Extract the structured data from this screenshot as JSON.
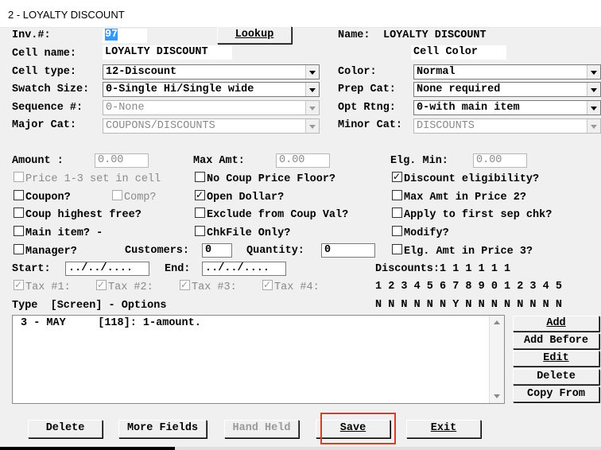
{
  "window": {
    "title": "2 - LOYALTY DISCOUNT"
  },
  "form": {
    "inv_label": "Inv.#:",
    "inv_value": "97",
    "lookup_label": "Lookup",
    "name_label": "Name:",
    "name_value": "LOYALTY DISCOUNT",
    "cell_name_label": "Cell name:",
    "cell_name_value": "LOYALTY DISCOUNT",
    "cell_color_label": "Cell Color",
    "cell_type_label": "Cell type:",
    "cell_type_value": "12-Discount",
    "color_label": "Color:",
    "color_value": "Normal",
    "swatch_label": "Swatch Size:",
    "swatch_value": "0-Single Hi/Single wide",
    "prep_label": "Prep Cat:",
    "prep_value": "None required",
    "sequence_label": "Sequence #:",
    "sequence_value": "0-None",
    "opt_label": "Opt Rtng:",
    "opt_value": "0-with main item",
    "major_label": "Major Cat:",
    "major_value": "COUPONS/DISCOUNTS",
    "minor_label": "Minor Cat:",
    "minor_value": "DISCOUNTS",
    "amount_label": "Amount :",
    "amount_value": "0.00",
    "maxamt_label": "Max Amt:",
    "maxamt_value": "0.00",
    "elgmin_label": "Elg. Min:",
    "elgmin_value": "0.00",
    "customers_label": "Customers:",
    "customers_value": "0",
    "quantity_label": "Quantity:",
    "quantity_value": "0",
    "start_label": "Start:",
    "start_value": "../../....",
    "end_label": "End:",
    "end_value": "../../...."
  },
  "checkboxes": {
    "price13": {
      "label": "Price 1-3 set in cell",
      "checked": false
    },
    "no_coup_floor": {
      "label": "No Coup Price Floor?",
      "checked": false
    },
    "discount_elig": {
      "label": "Discount eligibility?",
      "checked": true
    },
    "coupon": {
      "label": "Coupon?",
      "checked": false
    },
    "comp": {
      "label": "Comp?",
      "checked": false
    },
    "open_dollar": {
      "label": "Open Dollar?",
      "checked": true
    },
    "max_amt_price2": {
      "label": "Max Amt in Price 2?",
      "checked": false
    },
    "coup_highest": {
      "label": "Coup highest free?",
      "checked": false
    },
    "exclude_coup": {
      "label": "Exclude from Coup Val?",
      "checked": false
    },
    "apply_first": {
      "label": "Apply to first sep chk?",
      "checked": false
    },
    "main_item": {
      "label": "Main item? -",
      "checked": false
    },
    "chkfile": {
      "label": "ChkFile Only?",
      "checked": false
    },
    "modify": {
      "label": "Modify?",
      "checked": false
    },
    "manager": {
      "label": "Manager?",
      "checked": false
    },
    "elg_amt_price3": {
      "label": "Elg. Amt in Price 3?",
      "checked": false
    },
    "tax1": {
      "label": "Tax #1:",
      "checked": true
    },
    "tax2": {
      "label": "Tax #2:",
      "checked": true
    },
    "tax3": {
      "label": "Tax #3:",
      "checked": true
    },
    "tax4": {
      "label": "Tax #4:",
      "checked": true
    }
  },
  "discounts": {
    "label": "Discounts:",
    "tens": "          1 1 1 1 1 1",
    "ones": "1 2 3 4 5 6 7 8 9 0 1 2 3 4 5",
    "flags": "N N N N N N Y N N N N N N N N"
  },
  "options": {
    "header": "Type  [Screen] - Options",
    "rows": [
      "3 - MAY     [118]: 1-amount."
    ]
  },
  "side_buttons": {
    "add": "Add",
    "add_before": "Add Before",
    "edit": "Edit",
    "delete": "Delete",
    "copy_from": "Copy From"
  },
  "bottom_buttons": {
    "delete": "Delete",
    "more_fields": "More Fields",
    "hand_held": "Hand Held",
    "save": "Save",
    "exit": "Exit"
  },
  "colors": {
    "highlight": "#e23a1e",
    "selection": "#3399ff"
  }
}
